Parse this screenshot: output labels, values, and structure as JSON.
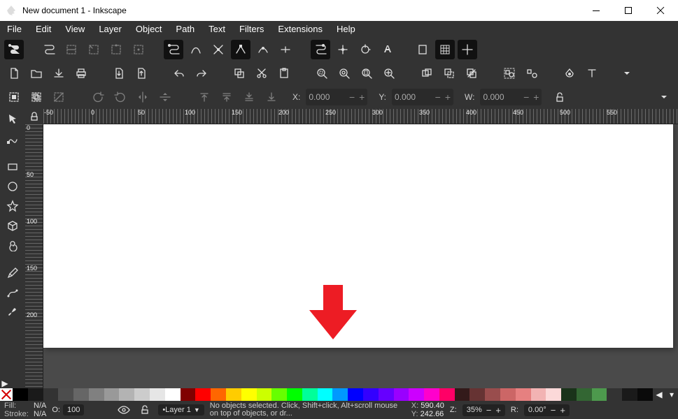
{
  "window": {
    "title": "New document 1 - Inkscape"
  },
  "menu": {
    "items": [
      "File",
      "Edit",
      "View",
      "Layer",
      "Object",
      "Path",
      "Text",
      "Filters",
      "Extensions",
      "Help"
    ]
  },
  "coords_toolbar": {
    "x_label": "X:",
    "x_value": "0.000",
    "y_label": "Y:",
    "y_value": "0.000",
    "w_label": "W:",
    "w_value": "0.000"
  },
  "ruler_h": [
    "-50",
    "0",
    "50",
    "100",
    "150",
    "200",
    "250",
    "300",
    "350",
    "400",
    "450",
    "500",
    "550"
  ],
  "ruler_v": [
    "0",
    "50",
    "100",
    "150",
    "200"
  ],
  "palette": [
    "#000000",
    "#1a1a1a",
    "#333333",
    "#4d4d4d",
    "#666666",
    "#808080",
    "#999999",
    "#b3b3b3",
    "#cccccc",
    "#e6e6e6",
    "#ffffff",
    "#800000",
    "#ff0000",
    "#ff6600",
    "#ffcc00",
    "#ffff00",
    "#ccff00",
    "#66ff00",
    "#00ff00",
    "#00ff99",
    "#00ffff",
    "#0099ff",
    "#0000ff",
    "#3300ff",
    "#6600ff",
    "#9900ff",
    "#cc00ff",
    "#ff00cc",
    "#ff0066",
    "#331a1a",
    "#663333",
    "#994d4d",
    "#cc6666",
    "#e68080",
    "#f2b3b3",
    "#fcd9d9",
    "#1a331a",
    "#336633",
    "#4d994d",
    "#333333",
    "#1a1a1a",
    "#0a0a0a"
  ],
  "status": {
    "fill_label": "Fill:",
    "fill_value": "N/A",
    "stroke_label": "Stroke:",
    "stroke_value": "N/A",
    "opacity_label": "O:",
    "opacity_value": "100",
    "layer_label": "•Layer 1",
    "message": "No objects selected. Click, Shift+click, Alt+scroll mouse on top of objects, or dr...",
    "x_key": "X:",
    "x_val": "590.40",
    "y_key": "Y:",
    "y_val": "242.66",
    "z_key": "Z:",
    "zoom": "35%",
    "r_key": "R:",
    "rot": "0.00°"
  }
}
